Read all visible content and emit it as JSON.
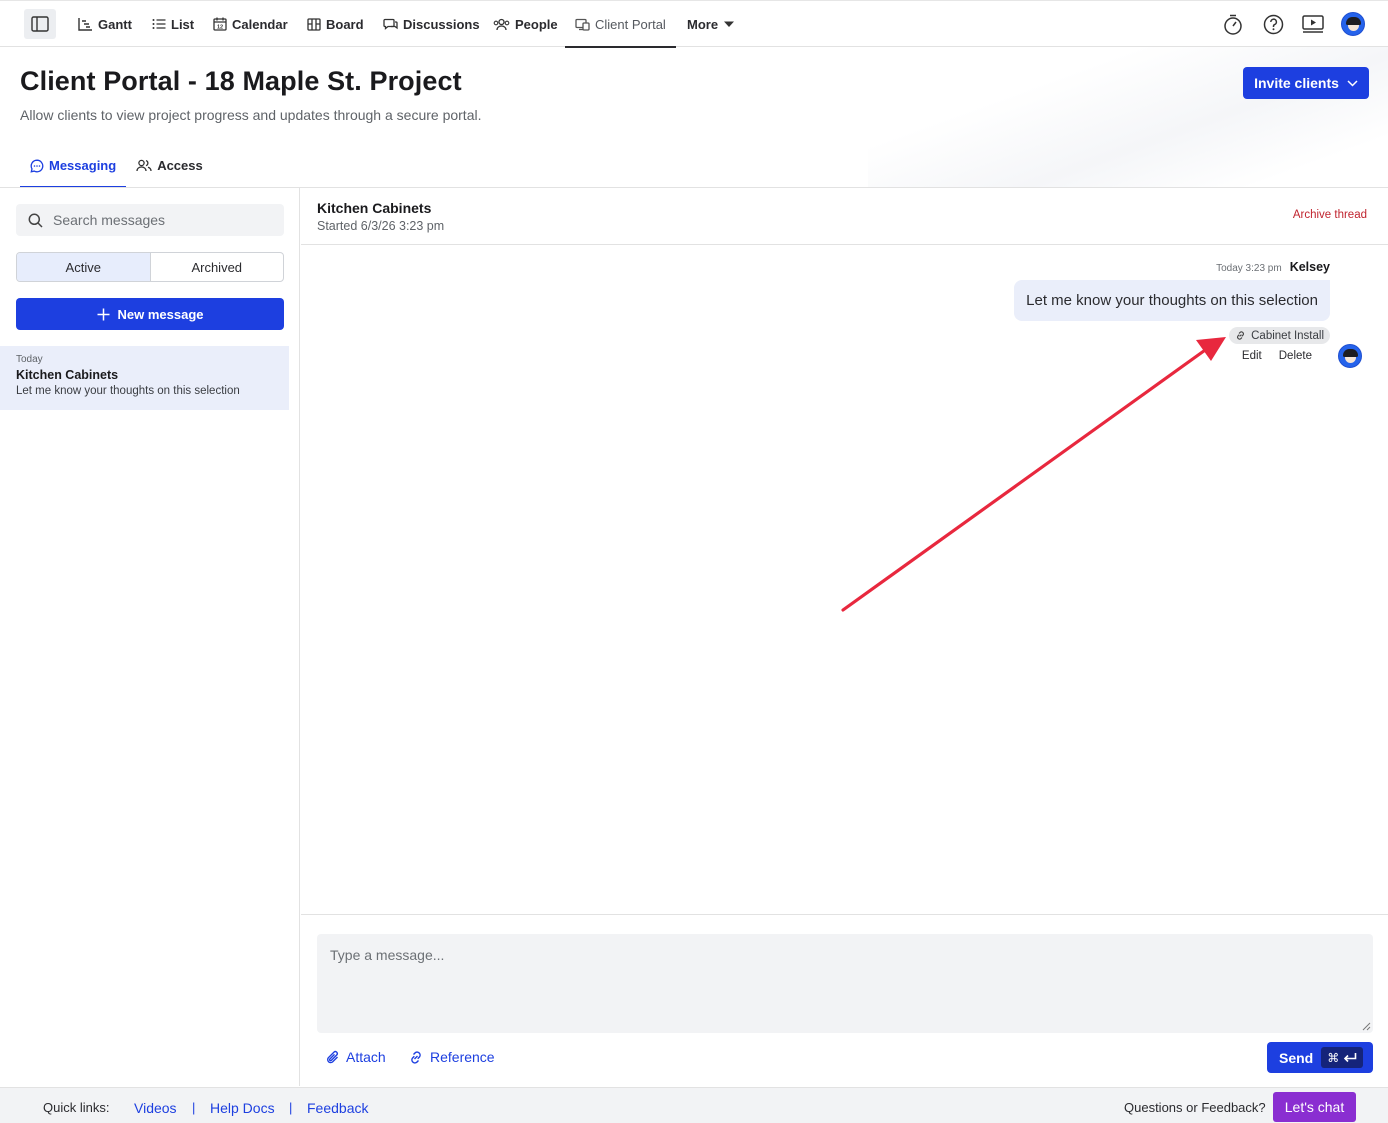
{
  "nav": {
    "items": [
      {
        "label": "Gantt",
        "icon": "gantt-icon"
      },
      {
        "label": "List",
        "icon": "list-icon"
      },
      {
        "label": "Calendar",
        "icon": "calendar-icon"
      },
      {
        "label": "Board",
        "icon": "board-icon"
      },
      {
        "label": "Discussions",
        "icon": "discussions-icon"
      },
      {
        "label": "People",
        "icon": "people-icon"
      },
      {
        "label": "Client Portal",
        "icon": "client-portal-icon",
        "active": true
      },
      {
        "label": "More",
        "icon": "caret-down-icon"
      }
    ],
    "right_icons": [
      "timer-icon",
      "help-icon",
      "video-icon",
      "user-avatar"
    ]
  },
  "header": {
    "title": "Client Portal - 18 Maple St. Project",
    "subtitle": "Allow clients to view project progress and updates through a secure portal.",
    "invite_label": "Invite clients"
  },
  "tabs": [
    {
      "label": "Messaging",
      "icon": "chat-bubble-icon",
      "active": true
    },
    {
      "label": "Access",
      "icon": "users-icon"
    }
  ],
  "sidebar": {
    "search_placeholder": "Search messages",
    "segments": [
      {
        "label": "Active",
        "active": true
      },
      {
        "label": "Archived"
      }
    ],
    "new_message_label": "New message",
    "threads": [
      {
        "date": "Today",
        "title": "Kitchen Cabinets",
        "snippet": "Let me know your thoughts on this selection"
      }
    ]
  },
  "thread": {
    "title": "Kitchen Cabinets",
    "started": "Started 6/3/26 3:23 pm",
    "archive_label": "Archive thread",
    "messages": [
      {
        "time": "Today 3:23 pm",
        "author": "Kelsey",
        "text": "Let me know your thoughts on this selection",
        "reference": "Cabinet Install",
        "actions": [
          "Edit",
          "Delete"
        ]
      }
    ]
  },
  "composer": {
    "placeholder": "Type a message...",
    "attach_label": "Attach",
    "reference_label": "Reference",
    "send_label": "Send",
    "send_shortcut": "⌘"
  },
  "footer": {
    "quick_links_label": "Quick links:",
    "links": [
      "Videos",
      "Help Docs",
      "Feedback"
    ],
    "separator": "|",
    "feedback_label": "Questions or Feedback?",
    "chat_label": "Let's chat"
  },
  "colors": {
    "accent": "#1d3fe0",
    "danger": "#c0242f",
    "chat": "#8a2ed1",
    "bubble": "#eaeefa",
    "annotation_arrow": "#e8283e"
  }
}
